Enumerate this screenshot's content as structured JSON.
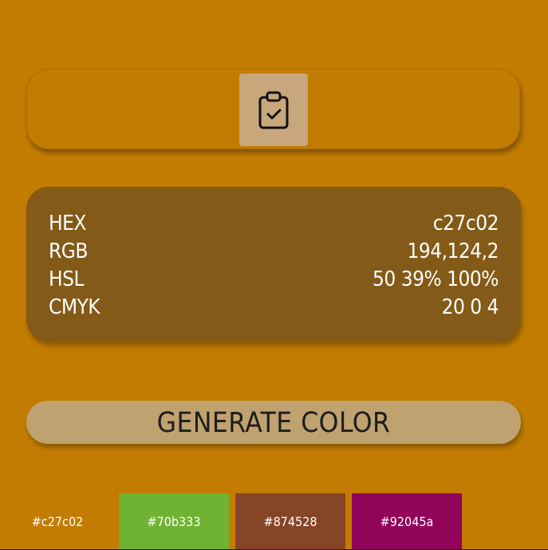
{
  "app": {
    "background_color": "#c27c02"
  },
  "copy_section": {
    "icon": "clipboard-check-icon",
    "button_color": "#c8a77c"
  },
  "color_info": {
    "rows": [
      {
        "label": "HEX",
        "value": "c27c02"
      },
      {
        "label": "RGB",
        "value": "194,124,2"
      },
      {
        "label": "HSL",
        "value": "50 39% 100%"
      },
      {
        "label": "CMYK",
        "value": "20 0 4"
      }
    ],
    "panel_color": "#835a17"
  },
  "generate": {
    "label": "GENERATE COLOR",
    "button_color": "#bfa26f",
    "text_color": "#1d1d1d"
  },
  "history": {
    "swatches": [
      {
        "label": "#c27c02",
        "color": "#c27c02"
      },
      {
        "label": "#70b333",
        "color": "#70b333"
      },
      {
        "label": "#874528",
        "color": "#874528"
      },
      {
        "label": "#92045a",
        "color": "#92045a"
      }
    ]
  }
}
